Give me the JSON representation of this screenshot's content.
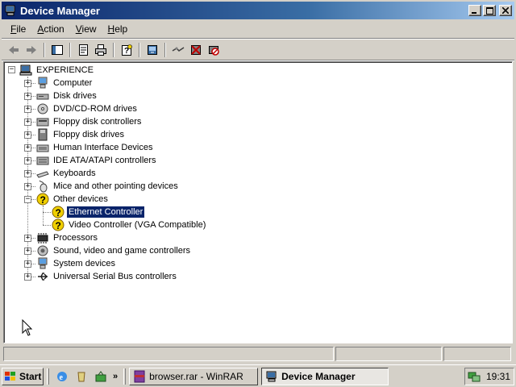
{
  "window": {
    "title": "Device Manager"
  },
  "menu": {
    "items": [
      {
        "underline": "F",
        "rest": "ile"
      },
      {
        "underline": "A",
        "rest": "ction"
      },
      {
        "underline": "V",
        "rest": "iew"
      },
      {
        "underline": "H",
        "rest": "elp"
      }
    ]
  },
  "tree": {
    "root": "EXPERIENCE",
    "nodes": [
      {
        "label": "Computer",
        "icon": "computer-icon"
      },
      {
        "label": "Disk drives",
        "icon": "disk-drive-icon"
      },
      {
        "label": "DVD/CD-ROM drives",
        "icon": "cdrom-icon"
      },
      {
        "label": "Floppy disk controllers",
        "icon": "floppy-controller-icon"
      },
      {
        "label": "Floppy disk drives",
        "icon": "floppy-drive-icon"
      },
      {
        "label": "Human Interface Devices",
        "icon": "hid-icon"
      },
      {
        "label": "IDE ATA/ATAPI controllers",
        "icon": "ide-controller-icon"
      },
      {
        "label": "Keyboards",
        "icon": "keyboard-icon"
      },
      {
        "label": "Mice and other pointing devices",
        "icon": "mouse-icon"
      },
      {
        "label": "Other devices",
        "icon": "unknown-device-icon",
        "expanded": true
      },
      {
        "label": "Ethernet Controller",
        "icon": "unknown-device-icon",
        "child": true,
        "selected": true
      },
      {
        "label": "Video Controller (VGA Compatible)",
        "icon": "unknown-device-icon",
        "child": true
      },
      {
        "label": "Processors",
        "icon": "processor-icon"
      },
      {
        "label": "Sound, video and game controllers",
        "icon": "sound-icon"
      },
      {
        "label": "System devices",
        "icon": "system-icon"
      },
      {
        "label": "Universal Serial Bus controllers",
        "icon": "usb-icon"
      }
    ]
  },
  "taskbar": {
    "start_label": "Start",
    "tasks": [
      {
        "label": "browser.rar - WinRAR",
        "icon": "winrar-icon"
      },
      {
        "label": "Device Manager",
        "icon": "device-manager-icon",
        "active": true
      }
    ],
    "clock": "19:31"
  }
}
